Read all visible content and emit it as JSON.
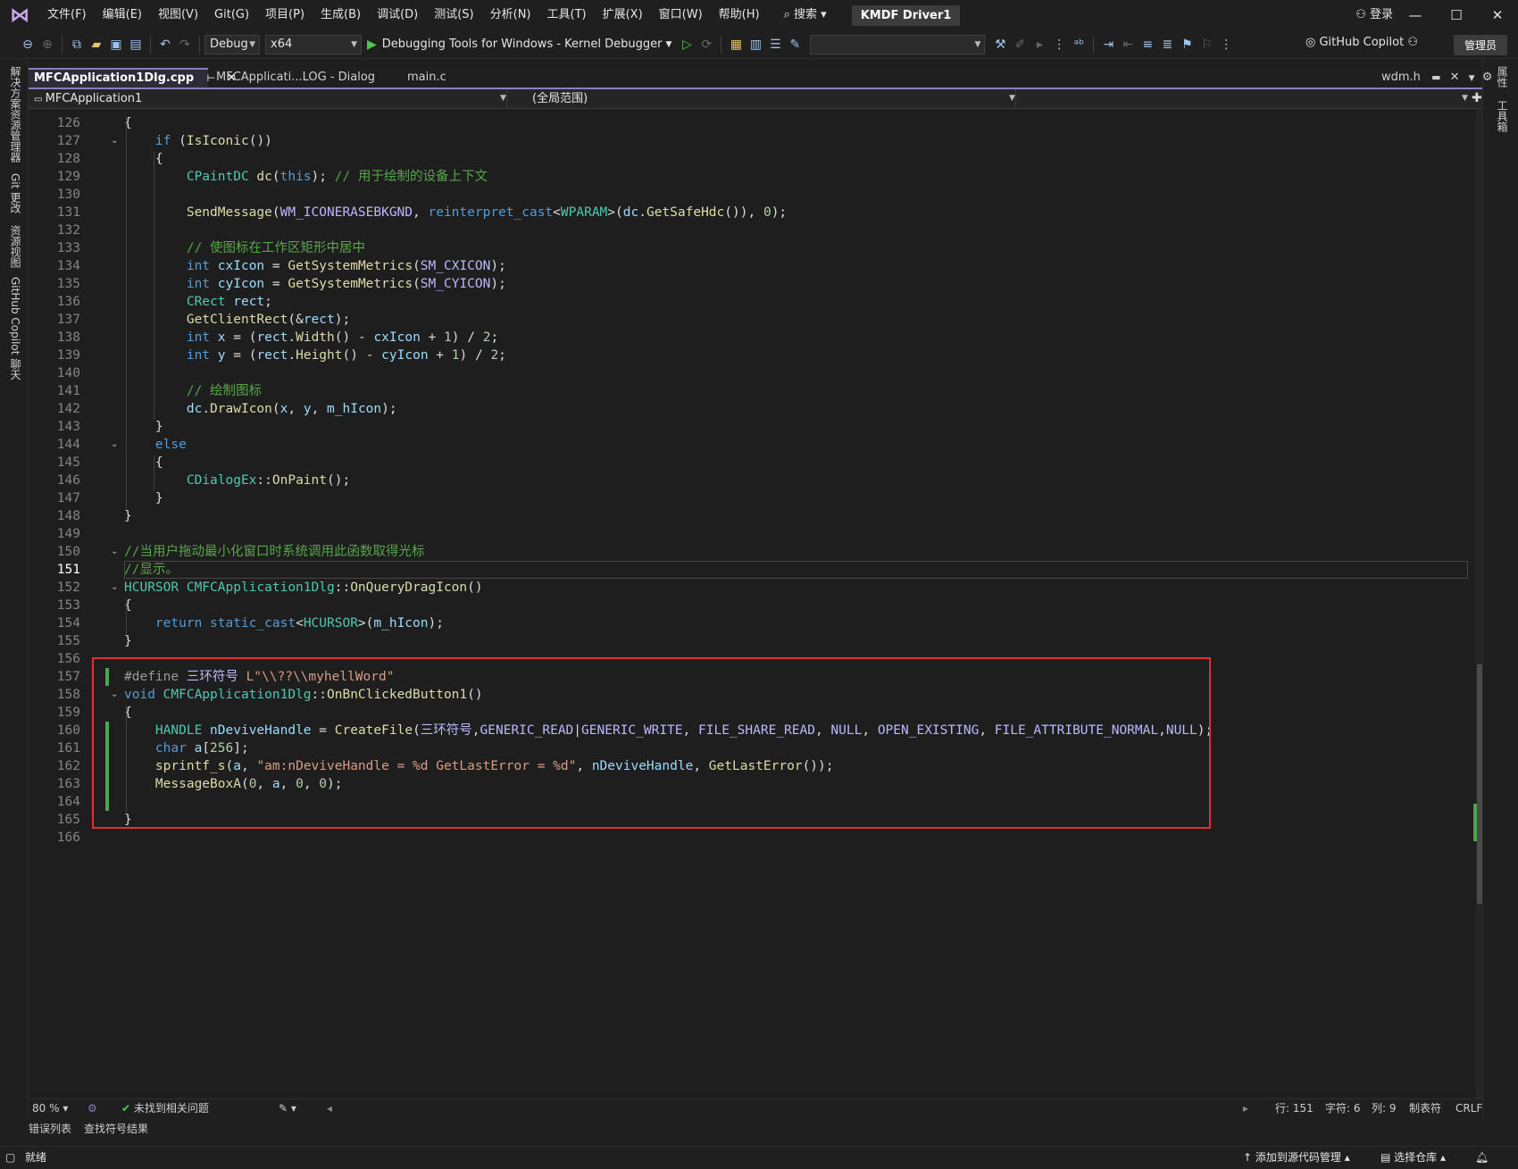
{
  "menu": {
    "items": [
      "文件(F)",
      "编辑(E)",
      "视图(V)",
      "Git(G)",
      "项目(P)",
      "生成(B)",
      "调试(D)",
      "测试(S)",
      "分析(N)",
      "工具(T)",
      "扩展(X)",
      "窗口(W)",
      "帮助(H)"
    ],
    "search": "搜索",
    "solution": "KMDF Driver1",
    "login": "登录"
  },
  "toolbar": {
    "config": "Debug",
    "platform": "x64",
    "debugger": "Debugging Tools for Windows - Kernel Debugger",
    "copilot": "GitHub Copilot",
    "admin": "管理员"
  },
  "left_rail": [
    "解决方案资源管理器",
    "Git 更改",
    "资源视图",
    "GitHub Copilot 聊天"
  ],
  "right_rail": [
    "属性",
    "工具箱"
  ],
  "tabs": [
    {
      "label": "MFCApplication1Dlg.cpp",
      "pin": "⊢",
      "close": "✕"
    },
    {
      "label": "MFCApplicati...LOG - Dialog"
    },
    {
      "label": "main.c"
    },
    {
      "label": "wdm.h"
    }
  ],
  "navbar": {
    "project": "MFCApplication1",
    "scope": "(全局范围)"
  },
  "code": {
    "current_line": 151,
    "lines": [
      {
        "n": 126,
        "t": "{"
      },
      {
        "n": 127,
        "t": "    if (IsIconic())"
      },
      {
        "n": 128,
        "t": "    {"
      },
      {
        "n": 129,
        "t": "        CPaintDC dc(this); // 用于绘制的设备上下文"
      },
      {
        "n": 130,
        "t": ""
      },
      {
        "n": 131,
        "t": "        SendMessage(WM_ICONERASEBKGND, reinterpret_cast<WPARAM>(dc.GetSafeHdc()), 0);"
      },
      {
        "n": 132,
        "t": ""
      },
      {
        "n": 133,
        "t": "        // 使图标在工作区矩形中居中"
      },
      {
        "n": 134,
        "t": "        int cxIcon = GetSystemMetrics(SM_CXICON);"
      },
      {
        "n": 135,
        "t": "        int cyIcon = GetSystemMetrics(SM_CYICON);"
      },
      {
        "n": 136,
        "t": "        CRect rect;"
      },
      {
        "n": 137,
        "t": "        GetClientRect(&rect);"
      },
      {
        "n": 138,
        "t": "        int x = (rect.Width() - cxIcon + 1) / 2;"
      },
      {
        "n": 139,
        "t": "        int y = (rect.Height() - cyIcon + 1) / 2;"
      },
      {
        "n": 140,
        "t": ""
      },
      {
        "n": 141,
        "t": "        // 绘制图标"
      },
      {
        "n": 142,
        "t": "        dc.DrawIcon(x, y, m_hIcon);"
      },
      {
        "n": 143,
        "t": "    }"
      },
      {
        "n": 144,
        "t": "    else"
      },
      {
        "n": 145,
        "t": "    {"
      },
      {
        "n": 146,
        "t": "        CDialogEx::OnPaint();"
      },
      {
        "n": 147,
        "t": "    }"
      },
      {
        "n": 148,
        "t": "}"
      },
      {
        "n": 149,
        "t": ""
      },
      {
        "n": 150,
        "t": "//当用户拖动最小化窗口时系统调用此函数取得光标"
      },
      {
        "n": 151,
        "t": "//显示。"
      },
      {
        "n": 152,
        "t": "HCURSOR CMFCApplication1Dlg::OnQueryDragIcon()"
      },
      {
        "n": 153,
        "t": "{"
      },
      {
        "n": 154,
        "t": "    return static_cast<HCURSOR>(m_hIcon);"
      },
      {
        "n": 155,
        "t": "}"
      },
      {
        "n": 156,
        "t": ""
      },
      {
        "n": 157,
        "t": "#define 三环符号 L\"\\\\??\\\\myhellWord\""
      },
      {
        "n": 158,
        "t": "void CMFCApplication1Dlg::OnBnClickedButton1()"
      },
      {
        "n": 159,
        "t": "{"
      },
      {
        "n": 160,
        "t": "    HANDLE nDeviveHandle = CreateFile(三环符号,GENERIC_READ|GENERIC_WRITE, FILE_SHARE_READ, NULL, OPEN_EXISTING, FILE_ATTRIBUTE_NORMAL,NULL);"
      },
      {
        "n": 161,
        "t": "    char a[256];"
      },
      {
        "n": 162,
        "t": "    sprintf_s(a, \"am:nDeviveHandle = %d GetLastError = %d\", nDeviveHandle, GetLastError());"
      },
      {
        "n": 163,
        "t": "    MessageBoxA(0, a, 0, 0);"
      },
      {
        "n": 164,
        "t": ""
      },
      {
        "n": 165,
        "t": "}"
      },
      {
        "n": 166,
        "t": ""
      }
    ]
  },
  "editor_status": {
    "zoom": "80 %",
    "issues": "未找到相关问题",
    "line": "行: 151",
    "char": "字符: 6",
    "col": "列: 9",
    "tabs": "制表符",
    "eol": "CRLF"
  },
  "panel_tabs": [
    "错误列表",
    "查找符号结果"
  ],
  "statusbar": {
    "ready": "就绪",
    "add_source": "添加到源代码管理",
    "select_repo": "选择仓库"
  },
  "colors": {
    "highlight_box": "#e03030",
    "accent": "#8e7cc3",
    "change_bar": "#4da64d"
  }
}
